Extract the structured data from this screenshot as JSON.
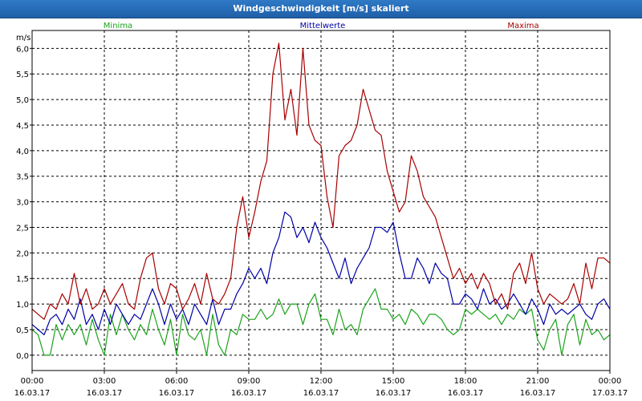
{
  "window": {
    "title": "Windgeschwindigkeit [m/s] skaliert"
  },
  "chart_data": {
    "type": "line",
    "title": "Windgeschwindigkeit [m/s] skaliert",
    "ylabel": "m/s",
    "xlabel": "",
    "ylim": [
      -0.3,
      6.35
    ],
    "xlim": [
      0,
      24
    ],
    "grid": true,
    "legend_placement": "top",
    "y_ticks": [
      "6,0",
      "5,5",
      "5,0",
      "4,5",
      "4,0",
      "3,5",
      "3,0",
      "2,5",
      "2,0",
      "1,5",
      "1,0",
      "0,5",
      "0,0"
    ],
    "y_tick_values": [
      6.0,
      5.5,
      5.0,
      4.5,
      4.0,
      3.5,
      3.0,
      2.5,
      2.0,
      1.5,
      1.0,
      0.5,
      0.0
    ],
    "x_ticks": [
      {
        "time": "00:00",
        "date": "16.03.17",
        "hour": 0
      },
      {
        "time": "03:00",
        "date": "16.03.17",
        "hour": 3
      },
      {
        "time": "06:00",
        "date": "16.03.17",
        "hour": 6
      },
      {
        "time": "09:00",
        "date": "16.03.17",
        "hour": 9
      },
      {
        "time": "12:00",
        "date": "16.03.17",
        "hour": 12
      },
      {
        "time": "15:00",
        "date": "16.03.17",
        "hour": 15
      },
      {
        "time": "18:00",
        "date": "16.03.17",
        "hour": 18
      },
      {
        "time": "21:00",
        "date": "16.03.17",
        "hour": 21
      },
      {
        "time": "00:00",
        "date": "17.03.17",
        "hour": 24
      }
    ],
    "series": [
      {
        "name": "Minima",
        "color": "#1aa31a",
        "legend_position": "left",
        "x": [
          0,
          0.25,
          0.5,
          0.75,
          1.0,
          1.25,
          1.5,
          1.75,
          2.0,
          2.25,
          2.5,
          2.75,
          3.0,
          3.25,
          3.5,
          3.75,
          4.0,
          4.25,
          4.5,
          4.75,
          5.0,
          5.25,
          5.5,
          5.75,
          6.0,
          6.25,
          6.5,
          6.75,
          7.0,
          7.25,
          7.5,
          7.75,
          8.0,
          8.25,
          8.5,
          8.75,
          9.0,
          9.25,
          9.5,
          9.75,
          10.0,
          10.25,
          10.5,
          10.75,
          11.0,
          11.25,
          11.5,
          11.75,
          12.0,
          12.25,
          12.5,
          12.75,
          13.0,
          13.25,
          13.5,
          13.75,
          14.0,
          14.25,
          14.5,
          14.75,
          15.0,
          15.25,
          15.5,
          15.75,
          16.0,
          16.25,
          16.5,
          16.75,
          17.0,
          17.25,
          17.5,
          17.75,
          18.0,
          18.25,
          18.5,
          18.75,
          19.0,
          19.25,
          19.5,
          19.75,
          20.0,
          20.25,
          20.5,
          20.75,
          21.0,
          21.25,
          21.5,
          21.75,
          22.0,
          22.25,
          22.5,
          22.75,
          23.0,
          23.25,
          23.5,
          23.75,
          24.0
        ],
        "values": [
          0.5,
          0.4,
          0.0,
          0.0,
          0.6,
          0.3,
          0.6,
          0.4,
          0.6,
          0.2,
          0.7,
          0.3,
          0.0,
          0.8,
          0.4,
          0.8,
          0.5,
          0.3,
          0.6,
          0.4,
          0.9,
          0.5,
          0.2,
          0.7,
          0.0,
          0.8,
          0.4,
          0.3,
          0.5,
          0.0,
          0.8,
          0.2,
          0.0,
          0.5,
          0.4,
          0.8,
          0.7,
          0.7,
          0.9,
          0.7,
          0.8,
          1.1,
          0.8,
          1.0,
          1.0,
          0.6,
          1.0,
          1.2,
          0.7,
          0.7,
          0.4,
          0.9,
          0.5,
          0.6,
          0.4,
          0.9,
          1.1,
          1.3,
          0.9,
          0.9,
          0.7,
          0.8,
          0.6,
          0.9,
          0.8,
          0.6,
          0.8,
          0.8,
          0.7,
          0.5,
          0.4,
          0.5,
          0.9,
          0.8,
          0.9,
          0.8,
          0.7,
          0.8,
          0.6,
          0.8,
          0.7,
          0.9,
          0.8,
          0.9,
          0.3,
          0.1,
          0.5,
          0.7,
          0.0,
          0.6,
          0.8,
          0.2,
          0.7,
          0.4,
          0.5,
          0.3,
          0.4
        ]
      },
      {
        "name": "Mittelwerte",
        "color": "#0000a8",
        "legend_position": "center",
        "x": [
          0,
          0.25,
          0.5,
          0.75,
          1.0,
          1.25,
          1.5,
          1.75,
          2.0,
          2.25,
          2.5,
          2.75,
          3.0,
          3.25,
          3.5,
          3.75,
          4.0,
          4.25,
          4.5,
          4.75,
          5.0,
          5.25,
          5.5,
          5.75,
          6.0,
          6.25,
          6.5,
          6.75,
          7.0,
          7.25,
          7.5,
          7.75,
          8.0,
          8.25,
          8.5,
          8.75,
          9.0,
          9.25,
          9.5,
          9.75,
          10.0,
          10.25,
          10.5,
          10.75,
          11.0,
          11.25,
          11.5,
          11.75,
          12.0,
          12.25,
          12.5,
          12.75,
          13.0,
          13.25,
          13.5,
          13.75,
          14.0,
          14.25,
          14.5,
          14.75,
          15.0,
          15.25,
          15.5,
          15.75,
          16.0,
          16.25,
          16.5,
          16.75,
          17.0,
          17.25,
          17.5,
          17.75,
          18.0,
          18.25,
          18.5,
          18.75,
          19.0,
          19.25,
          19.5,
          19.75,
          20.0,
          20.25,
          20.5,
          20.75,
          21.0,
          21.25,
          21.5,
          21.75,
          22.0,
          22.25,
          22.5,
          22.75,
          23.0,
          23.25,
          23.5,
          23.75,
          24.0
        ],
        "values": [
          0.6,
          0.5,
          0.4,
          0.7,
          0.8,
          0.6,
          0.9,
          0.7,
          1.1,
          0.6,
          0.8,
          0.5,
          0.9,
          0.6,
          1.0,
          0.8,
          0.6,
          0.8,
          0.7,
          1.0,
          1.3,
          1.0,
          0.6,
          1.0,
          0.7,
          0.9,
          0.6,
          1.0,
          0.8,
          0.6,
          1.1,
          0.6,
          0.9,
          0.9,
          1.2,
          1.4,
          1.7,
          1.5,
          1.7,
          1.4,
          2.0,
          2.3,
          2.8,
          2.7,
          2.3,
          2.5,
          2.2,
          2.6,
          2.3,
          2.1,
          1.8,
          1.5,
          1.9,
          1.4,
          1.7,
          1.9,
          2.1,
          2.5,
          2.5,
          2.4,
          2.6,
          2.0,
          1.5,
          1.5,
          1.9,
          1.7,
          1.4,
          1.8,
          1.6,
          1.5,
          1.0,
          1.0,
          1.2,
          1.1,
          0.9,
          1.3,
          1.0,
          1.1,
          0.9,
          1.0,
          1.2,
          1.0,
          0.8,
          1.1,
          0.9,
          0.6,
          1.0,
          0.8,
          0.9,
          0.8,
          0.9,
          1.0,
          0.8,
          0.7,
          1.0,
          1.1,
          0.9
        ]
      },
      {
        "name": "Maxima",
        "color": "#a80000",
        "legend_position": "right",
        "x": [
          0,
          0.25,
          0.5,
          0.75,
          1.0,
          1.25,
          1.5,
          1.75,
          2.0,
          2.25,
          2.5,
          2.75,
          3.0,
          3.25,
          3.5,
          3.75,
          4.0,
          4.25,
          4.5,
          4.75,
          5.0,
          5.25,
          5.5,
          5.75,
          6.0,
          6.25,
          6.5,
          6.75,
          7.0,
          7.25,
          7.5,
          7.75,
          8.0,
          8.25,
          8.5,
          8.75,
          9.0,
          9.25,
          9.5,
          9.75,
          10.0,
          10.25,
          10.5,
          10.75,
          11.0,
          11.25,
          11.5,
          11.75,
          12.0,
          12.25,
          12.5,
          12.75,
          13.0,
          13.25,
          13.5,
          13.75,
          14.0,
          14.25,
          14.5,
          14.75,
          15.0,
          15.25,
          15.5,
          15.75,
          16.0,
          16.25,
          16.5,
          16.75,
          17.0,
          17.25,
          17.5,
          17.75,
          18.0,
          18.25,
          18.5,
          18.75,
          19.0,
          19.25,
          19.5,
          19.75,
          20.0,
          20.25,
          20.5,
          20.75,
          21.0,
          21.25,
          21.5,
          21.75,
          22.0,
          22.25,
          22.5,
          22.75,
          23.0,
          23.25,
          23.5,
          23.75,
          24.0
        ],
        "values": [
          0.9,
          0.8,
          0.7,
          1.0,
          0.9,
          1.2,
          1.0,
          1.6,
          1.0,
          1.3,
          0.9,
          1.0,
          1.3,
          1.0,
          1.2,
          1.4,
          1.0,
          0.9,
          1.5,
          1.9,
          2.0,
          1.3,
          1.0,
          1.4,
          1.3,
          0.9,
          1.1,
          1.4,
          1.0,
          1.6,
          1.1,
          1.0,
          1.2,
          1.5,
          2.5,
          3.1,
          2.3,
          2.8,
          3.4,
          3.8,
          5.5,
          6.1,
          4.6,
          5.2,
          4.3,
          6.0,
          4.5,
          4.2,
          4.1,
          3.1,
          2.5,
          3.9,
          4.1,
          4.2,
          4.5,
          5.2,
          4.8,
          4.4,
          4.3,
          3.6,
          3.2,
          2.8,
          3.0,
          3.9,
          3.6,
          3.1,
          2.9,
          2.7,
          2.3,
          1.9,
          1.5,
          1.7,
          1.4,
          1.6,
          1.3,
          1.6,
          1.4,
          1.0,
          1.2,
          0.9,
          1.6,
          1.8,
          1.4,
          2.0,
          1.3,
          1.0,
          1.2,
          1.1,
          1.0,
          1.1,
          1.4,
          1.0,
          1.8,
          1.3,
          1.9,
          1.9,
          1.8
        ]
      }
    ]
  }
}
